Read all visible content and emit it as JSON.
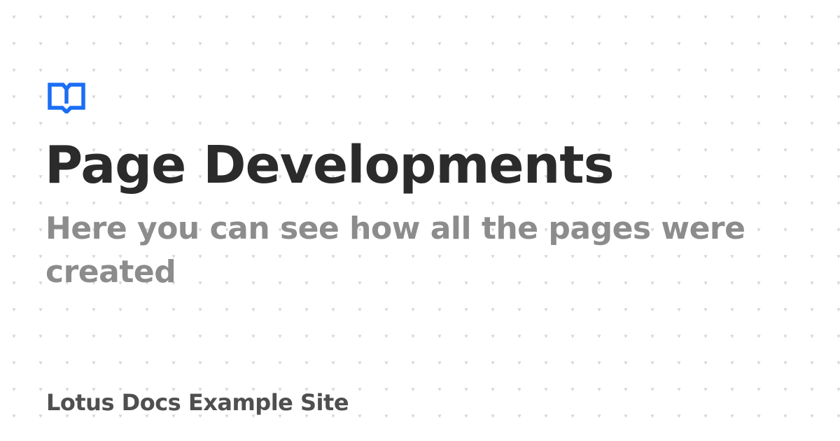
{
  "brand": {
    "icon": "book-open-icon",
    "accent_color": "#1a6ef5"
  },
  "page": {
    "title": "Page Developments",
    "description": "Here you can see how all the pages were created"
  },
  "site": {
    "name": "Lotus Docs Example Site"
  },
  "colors": {
    "title": "#2b2b2b",
    "description": "#8c8c8c",
    "site_name": "#4f4f4f",
    "pattern": "#d6d6d6"
  }
}
